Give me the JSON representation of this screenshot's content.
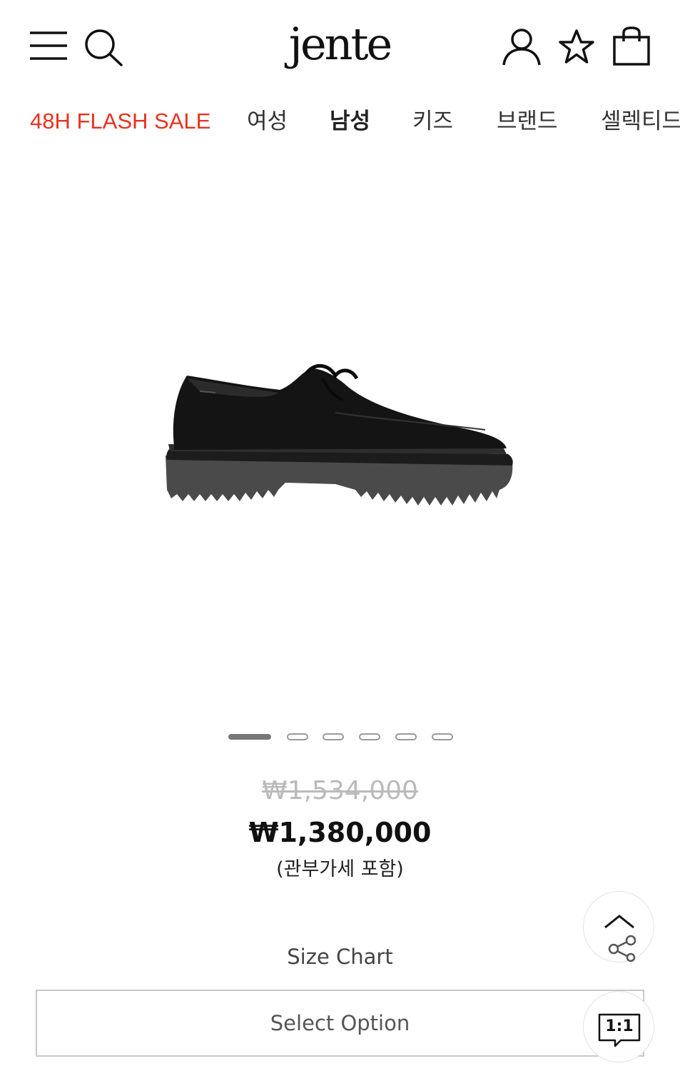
{
  "header": {
    "logo": "jente",
    "icons": [
      "menu-icon",
      "search-icon",
      "user-icon",
      "star-icon",
      "bag-icon"
    ]
  },
  "nav": {
    "items": [
      {
        "label": "48H FLASH SALE",
        "color": "#e8321e"
      },
      {
        "label": "여성"
      },
      {
        "label": "남성",
        "active": true
      },
      {
        "label": "키즈"
      },
      {
        "label": "브랜드"
      },
      {
        "label": "셀렉티드"
      }
    ]
  },
  "product": {
    "image": "black leather lace-up derby shoe with lug sole",
    "carousel": {
      "total": 6,
      "current": 1
    },
    "price_original": "₩1,534,000",
    "price_sale": "₩1,380,000",
    "price_note": "(관부가세 포함)"
  },
  "size_chart_label": "Size Chart",
  "select_option": {
    "label": "Select Option"
  },
  "floating": {
    "scroll_top_icon": "chevron-up-icon",
    "share_icon": "share-icon",
    "chat_label": "1:1"
  },
  "colors": {
    "sale": "#e8321e",
    "strike": "#bbbbbb",
    "text": "#222222"
  }
}
